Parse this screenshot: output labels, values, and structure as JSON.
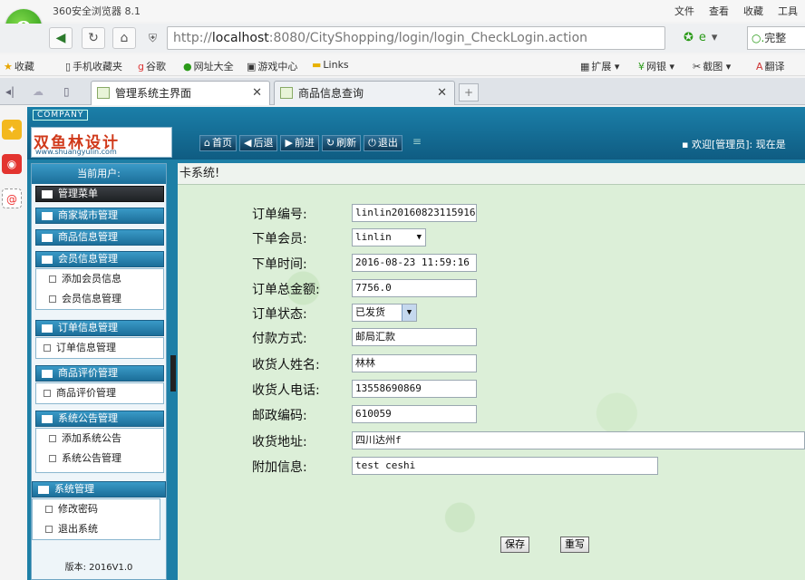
{
  "browser": {
    "title": "360安全浏览器 8.1",
    "menu": [
      "文件",
      "查看",
      "收藏",
      "工具"
    ],
    "url_prefix": "http://",
    "url_host": "localhost",
    "url_rest": ":8080/CityShopping/login/login_CheckLogin.action",
    "search_placeholder": "完整",
    "favorites": [
      "收藏",
      "手机收藏夹",
      "谷歌",
      "网址大全",
      "游戏中心",
      "Links"
    ],
    "extras": [
      "扩展",
      "网银",
      "截图",
      "翻译"
    ],
    "tabs": [
      {
        "label": "管理系统主界面",
        "active": true
      },
      {
        "label": "商品信息查询",
        "active": false
      }
    ]
  },
  "header": {
    "company": "COMPANY",
    "brand_title": "双鱼林设计",
    "brand_sub": "www.shuangyulin.com",
    "toolbar": [
      "首页",
      "后退",
      "前进",
      "刷新",
      "退出"
    ],
    "welcome": "欢迎[管理员]: 现在是"
  },
  "sidebar": {
    "current_user": "当前用户:",
    "version": "版本: 2016V1.0",
    "groups": [
      {
        "label": "管理菜单",
        "items": []
      },
      {
        "label": "商家城市管理",
        "items": []
      },
      {
        "label": "商品信息管理",
        "items": []
      },
      {
        "label": "会员信息管理",
        "items": [
          "添加会员信息",
          "会员信息管理"
        ]
      },
      {
        "label": "订单信息管理",
        "items": [
          "订单信息管理"
        ]
      },
      {
        "label": "商品评价管理",
        "items": [
          "商品评价管理"
        ]
      },
      {
        "label": "系统公告管理",
        "items": [
          "添加系统公告",
          "系统公告管理"
        ]
      },
      {
        "label": "系统管理",
        "items": [
          "修改密码",
          "退出系统"
        ]
      }
    ]
  },
  "content": {
    "title": "卡系统!",
    "form": [
      {
        "label": "订单编号:",
        "value": "linlin20160823115916"
      },
      {
        "label": "下单会员:",
        "value": "linlin"
      },
      {
        "label": "下单时间:",
        "value": "2016-08-23 11:59:16"
      },
      {
        "label": "订单总金额:",
        "value": "7756.0"
      },
      {
        "label": "订单状态:",
        "value": "已发货"
      },
      {
        "label": "付款方式:",
        "value": "邮局汇款"
      },
      {
        "label": "收货人姓名:",
        "value": "林林"
      },
      {
        "label": "收货人电话:",
        "value": "13558690869"
      },
      {
        "label": "邮政编码:",
        "value": "610059"
      },
      {
        "label": "收货地址:",
        "value": "四川达州f"
      },
      {
        "label": "附加信息:",
        "value": "test ceshi"
      }
    ],
    "save_label": "保存",
    "reset_label": "重写"
  }
}
